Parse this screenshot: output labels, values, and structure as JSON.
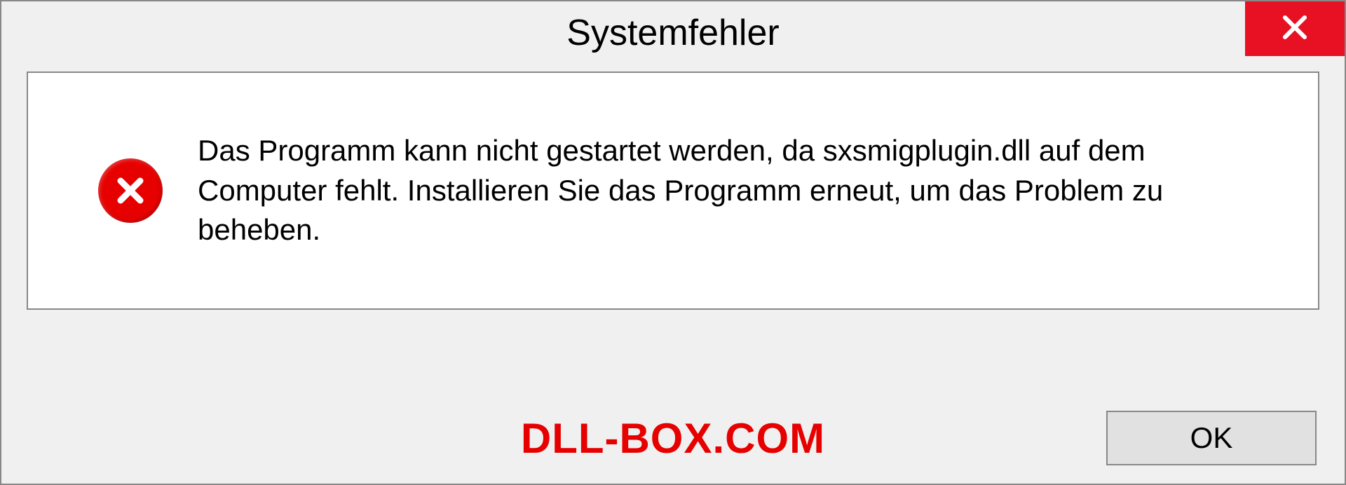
{
  "titlebar": {
    "title": "Systemfehler"
  },
  "content": {
    "message": "Das Programm kann nicht gestartet werden, da sxsmigplugin.dll auf dem Computer fehlt. Installieren Sie das Programm erneut, um das Problem zu beheben."
  },
  "footer": {
    "watermark": "DLL-BOX.COM",
    "ok_label": "OK"
  },
  "icons": {
    "close": "close-icon",
    "error": "error-circle-x-icon"
  },
  "colors": {
    "close_bg": "#e81123",
    "error_bg": "#e60000",
    "watermark": "#e60000",
    "dialog_bg": "#f0f0f0",
    "content_bg": "#ffffff",
    "border": "#888888"
  }
}
